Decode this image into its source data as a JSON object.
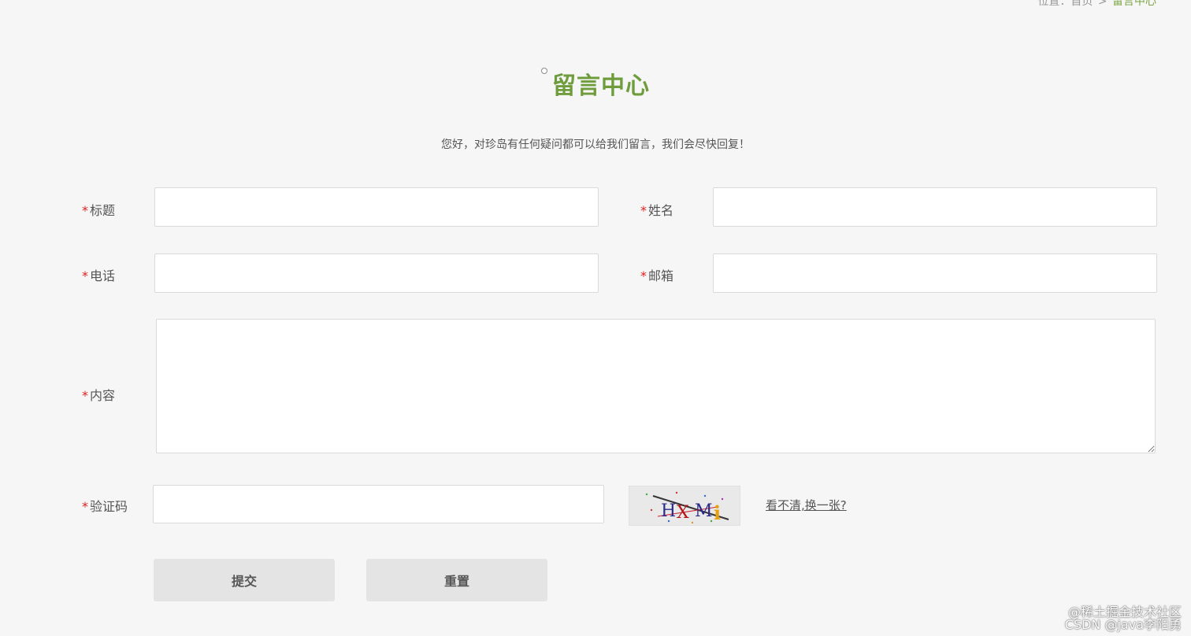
{
  "breadcrumb": {
    "position_label": "位置：",
    "home": "首页",
    "separator": ">",
    "current": "留言中心"
  },
  "title": "留言中心",
  "subtitle": "您好，对珍岛有任何疑问都可以给我们留言，我们会尽快回复！",
  "form": {
    "required_mark": "*",
    "title_label": "标题",
    "name_label": "姓名",
    "phone_label": "电话",
    "email_label": "邮箱",
    "content_label": "内容",
    "captcha_label": "验证码",
    "captcha_text": "HXMi",
    "captcha_refresh": "看不清,换一张?",
    "values": {
      "title": "",
      "name": "",
      "phone": "",
      "email": "",
      "content": "",
      "captcha": ""
    }
  },
  "buttons": {
    "submit": "提交",
    "reset": "重置"
  },
  "watermarks": {
    "line1": "@稀土掘金技术社区",
    "line2": "CSDN @java李阳勇"
  },
  "colors": {
    "accent": "#6f9c3d",
    "required": "#e02020",
    "background": "#f6f6f6",
    "button": "#e4e4e4"
  }
}
